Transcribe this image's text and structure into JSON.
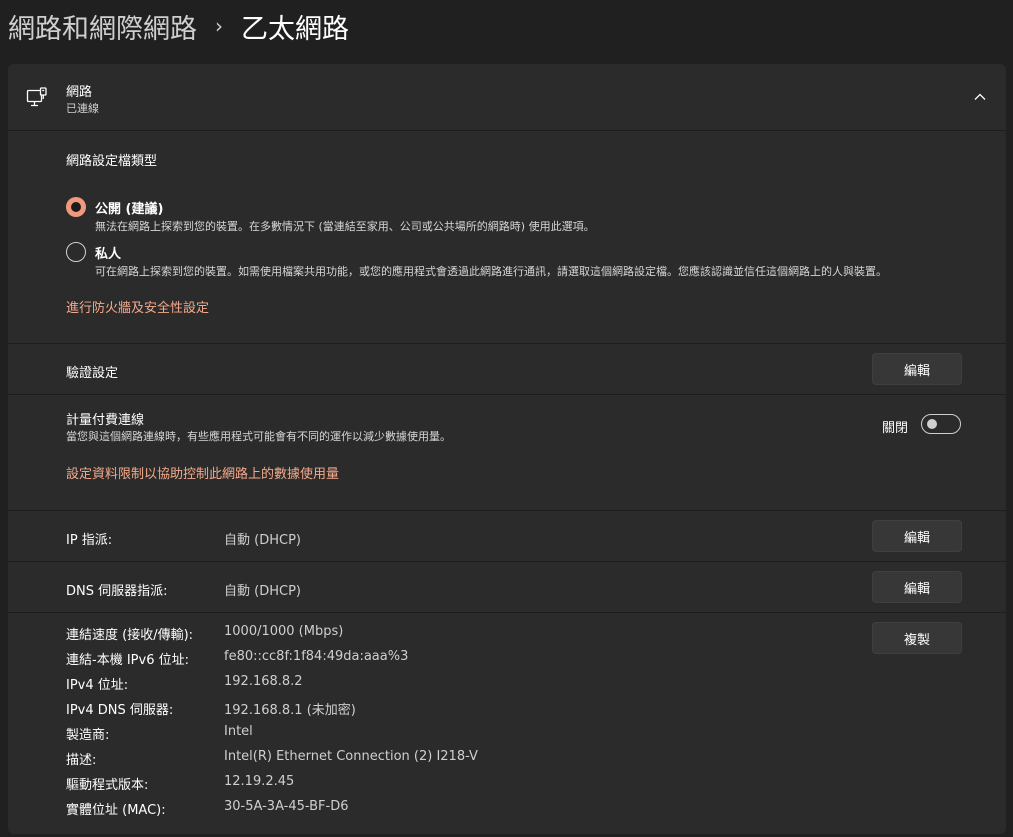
{
  "breadcrumb": {
    "parent": "網路和網際網路",
    "separator": "›",
    "current": "乙太網路"
  },
  "network": {
    "title": "網路",
    "status": "已連線",
    "icon": "network-monitor-icon",
    "collapse_icon": "chevron-up-icon"
  },
  "profile": {
    "heading": "網路設定檔類型",
    "options": [
      {
        "label": "公開 (建議)",
        "description": "無法在網路上探索到您的裝置。在多數情況下 (當連結至家用、公司或公共場所的網路時) 使用此選項。",
        "selected": true
      },
      {
        "label": "私人",
        "description": "可在網路上探索到您的裝置。如需使用檔案共用功能，或您的應用程式會透過此網路進行通訊，請選取這個網路設定檔。您應該認識並信任這個網路上的人與裝置。",
        "selected": false
      }
    ],
    "firewall_link": "進行防火牆及安全性設定"
  },
  "auth": {
    "label": "驗證設定",
    "button": "編輯"
  },
  "metered": {
    "label": "計量付費連線",
    "description": "當您與這個網路連線時，有些應用程式可能會有不同的運作以減少數據使用量。",
    "toggle_label": "關閉",
    "toggle_on": false,
    "data_limit_link": "設定資料限制以協助控制此網路上的數據使用量"
  },
  "ip": {
    "label": "IP 指派:",
    "value": "自動 (DHCP)",
    "button": "編輯"
  },
  "dns": {
    "label": "DNS 伺服器指派:",
    "value": "自動 (DHCP)",
    "button": "編輯"
  },
  "properties": {
    "copy_button": "複製",
    "rows": [
      {
        "label": "連結速度 (接收/傳輸):",
        "value": "1000/1000 (Mbps)"
      },
      {
        "label": "連結-本機 IPv6 位址:",
        "value": "fe80::cc8f:1f84:49da:aaa%3"
      },
      {
        "label": "IPv4 位址:",
        "value": "192.168.8.2"
      },
      {
        "label": "IPv4 DNS 伺服器:",
        "value": "192.168.8.1 (未加密)"
      },
      {
        "label": "製造商:",
        "value": "Intel"
      },
      {
        "label": "描述:",
        "value": "Intel(R) Ethernet Connection (2) I218-V"
      },
      {
        "label": "驅動程式版本:",
        "value": "12.19.2.45"
      },
      {
        "label": "實體位址 (MAC):",
        "value": "30-5A-3A-45-BF-D6"
      }
    ]
  },
  "colors": {
    "background": "#202020",
    "card": "#2b2b2b",
    "accent": "#ef9a7e",
    "link": "#f4a98a"
  }
}
